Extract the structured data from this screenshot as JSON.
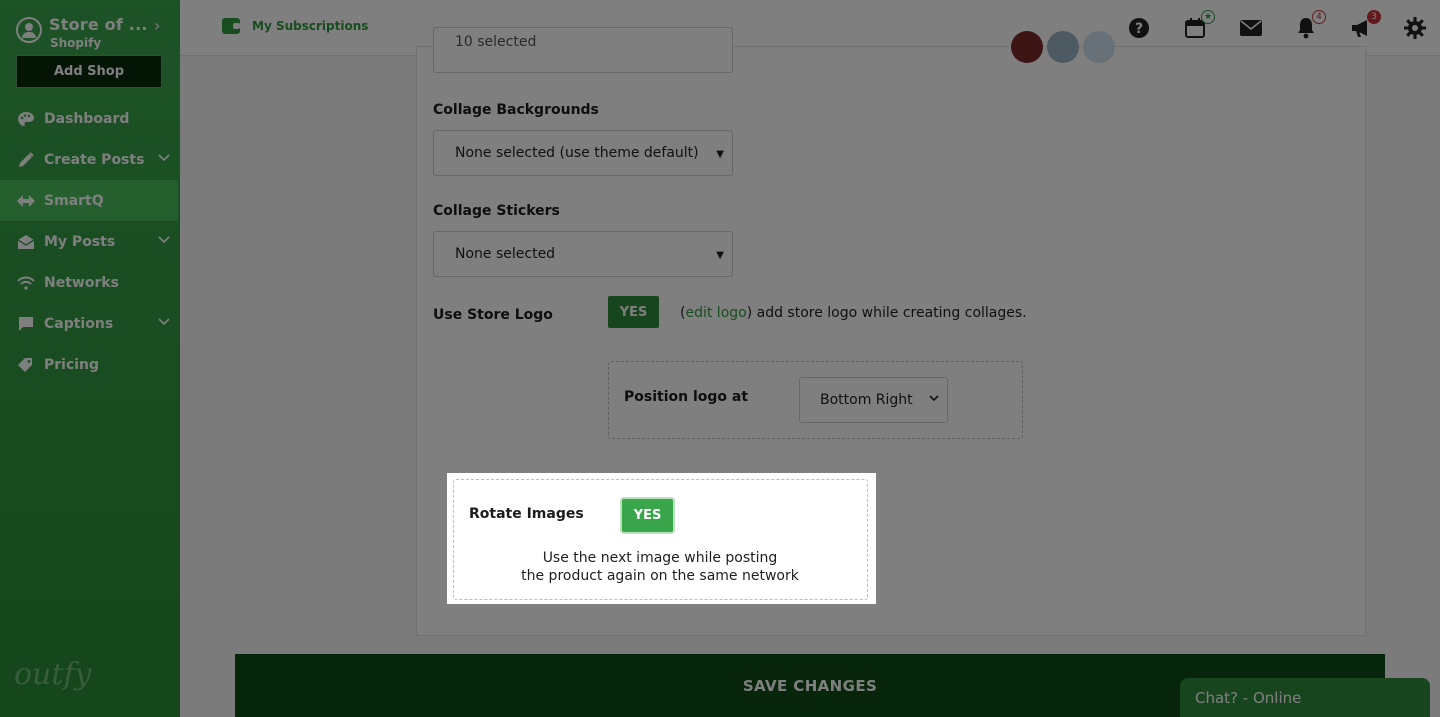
{
  "sidebar": {
    "store_name": "Store of ...",
    "store_platform": "Shopify",
    "add_shop_label": "Add Shop",
    "items": [
      {
        "label": "Dashboard",
        "icon": "palette-icon"
      },
      {
        "label": "Create Posts",
        "icon": "pencil-icon"
      },
      {
        "label": "SmartQ",
        "icon": "smartq-icon"
      },
      {
        "label": "My Posts",
        "icon": "envelope-open-icon"
      },
      {
        "label": "Networks",
        "icon": "wifi-icon"
      },
      {
        "label": "Captions",
        "icon": "comment-icon"
      },
      {
        "label": "Pricing",
        "icon": "tag-icon"
      }
    ],
    "brand": "outfy"
  },
  "topbar": {
    "subscriptions_label": "My Subscriptions",
    "calendar_badge": "★",
    "notifications_badge": "4",
    "announcements_badge": "3"
  },
  "form": {
    "partial_select_value": "10 selected",
    "collage_backgrounds_label": "Collage Backgrounds",
    "collage_backgrounds_value": "None selected (use theme default)",
    "collage_stickers_label": "Collage Stickers",
    "collage_stickers_value": "None selected",
    "use_store_logo_label": "Use Store Logo",
    "use_store_logo_toggle": "YES",
    "logo_note_open": "(",
    "logo_note_link": "edit logo",
    "logo_note_rest": ") add store logo while creating collages.",
    "position_logo_label": "Position logo at",
    "position_logo_value": "Bottom Right",
    "rotate_images_label": "Rotate Images",
    "rotate_images_toggle": "YES",
    "rotate_note_line1": "Use the next image while posting",
    "rotate_note_line2": "the product again on the same network"
  },
  "save_label": "SAVE CHANGES",
  "chat_label": "Chat? - Online",
  "colors": {
    "brand_green": "#3aa64c",
    "dark_green": "#0e4a15",
    "badge_red": "#c8323a"
  }
}
